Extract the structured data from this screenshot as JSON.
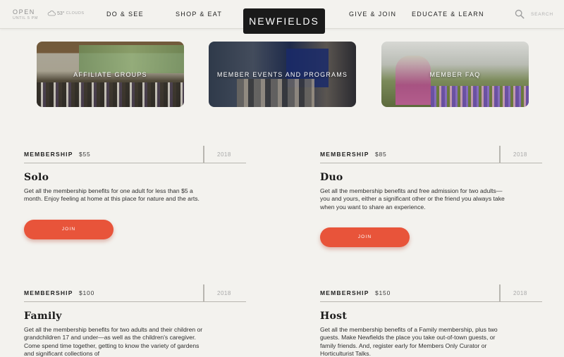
{
  "header": {
    "open_label": "OPEN",
    "open_until": "UNTIL 5 PM",
    "weather_temp": "53°",
    "weather_condition": "CLOUDS",
    "nav_left": [
      "DO & SEE",
      "SHOP & EAT"
    ],
    "logo": "NEWFIELDS",
    "nav_right": [
      "GIVE & JOIN",
      "EDUCATE & LEARN"
    ],
    "search_label": "SEARCH"
  },
  "cards": [
    {
      "label": "AFFILIATE GROUPS"
    },
    {
      "label": "MEMBER EVENTS AND PROGRAMS"
    },
    {
      "label": "MEMBER FAQ"
    }
  ],
  "memberships": [
    {
      "keyword": "MEMBERSHIP",
      "price": "$55",
      "year": "2018",
      "title": "Solo",
      "description": "Get all the membership benefits for one adult for less than $5 a month. Enjoy feeling at home at this place for nature and the arts.",
      "button": "JOIN"
    },
    {
      "keyword": "MEMBERSHIP",
      "price": "$85",
      "year": "2018",
      "title": "Duo",
      "description": "Get all the membership benefits and free admission for two adults—you and yours, either a significant other or the friend you always take when you want to share an experience.",
      "button": "JOIN"
    },
    {
      "keyword": "MEMBERSHIP",
      "price": "$100",
      "year": "2018",
      "title": "Family",
      "description": "Get all the membership benefits for two adults and their children or grandchildren 17 and under—as well as the children's caregiver. Come spend time together, getting to know the variety of gardens and significant collections of"
    },
    {
      "keyword": "MEMBERSHIP",
      "price": "$150",
      "year": "2018",
      "title": "Host",
      "description": "Get all the membership benefits of a Family membership, plus two guests. Make Newfields the place you take out-of-town guests, or family friends. And, register early for Members Only Curator or Horticulturist Talks."
    }
  ],
  "colors": {
    "background": "#f3f2ee",
    "accent": "#e8543a",
    "logo_bg": "#1a1a1a"
  },
  "icons": {
    "weather": "cloud-icon",
    "search": "search-icon"
  }
}
